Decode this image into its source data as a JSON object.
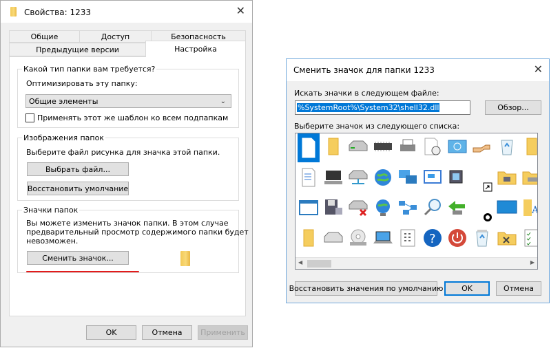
{
  "props": {
    "title": "Свойства: 1233",
    "tabs_row1": [
      "Общие",
      "Доступ",
      "Безопасность"
    ],
    "tabs_row2": [
      "Предыдущие версии",
      "Настройка"
    ],
    "question": "Какой тип папки вам требуется?",
    "optimize_label": "Оптимизировать эту папку:",
    "optimize_value": "Общие элементы",
    "apply_template": "Применять этот же шаблон ко всем подпапкам",
    "pictures_group": "Изображения папок",
    "pictures_desc": "Выберите файл рисунка для значка этой папки.",
    "choose_file": "Выбрать файл...",
    "restore_default": "Восстановить умолчание",
    "icons_group": "Значки папок",
    "icons_desc": [
      "Вы можете изменить значок папки. В этом случае",
      "предварительный просмотр содержимого папки будет",
      "невозможен."
    ],
    "change_icon": "Сменить значок...",
    "ok": "OK",
    "cancel": "Отмена",
    "apply": "Применить"
  },
  "icon_dialog": {
    "title": "Сменить значок для папки 1233",
    "search_label": "Искать значки в следующем файле:",
    "search_path": "%SystemRoot%\\System32\\shell32.dll",
    "browse": "Обзор...",
    "choose_label": "Выберите значок из следующего списка:",
    "restore_defaults": "Восстановить значения по умолчанию",
    "ok": "OK",
    "cancel": "Отмена",
    "icons": [
      [
        "document-icon",
        "folder-icon",
        "disk-drive-icon",
        "memory-chip-icon",
        "printer-icon",
        "clock-document-icon",
        "network-window-icon",
        "hand-share-icon",
        "recycle-bin-icon",
        "folder-icon"
      ],
      [
        "text-document-icon",
        "computer-icon",
        "network-drive-icon",
        "globe-icon",
        "network-computers-icon",
        "presentation-icon",
        "run-program-icon",
        "shortcut-arrow-icon",
        "folder-network-icon",
        "drive-folder-icon"
      ],
      [
        "window-icon",
        "floppy-save-icon",
        "disconnected-drive-icon",
        "globe-network-icon",
        "network-diagram-icon",
        "magnifier-icon",
        "green-arrow-icon",
        "blocked-icon",
        "monitor-icon",
        "folder-text-icon"
      ],
      [
        "folder-icon",
        "hard-drive-icon",
        "cd-drive-icon",
        "laptop-icon",
        "grid-document-icon",
        "help-icon",
        "power-icon",
        "recycle-bin-full-icon",
        "folder-tools-icon",
        "checklist-icon"
      ]
    ]
  }
}
